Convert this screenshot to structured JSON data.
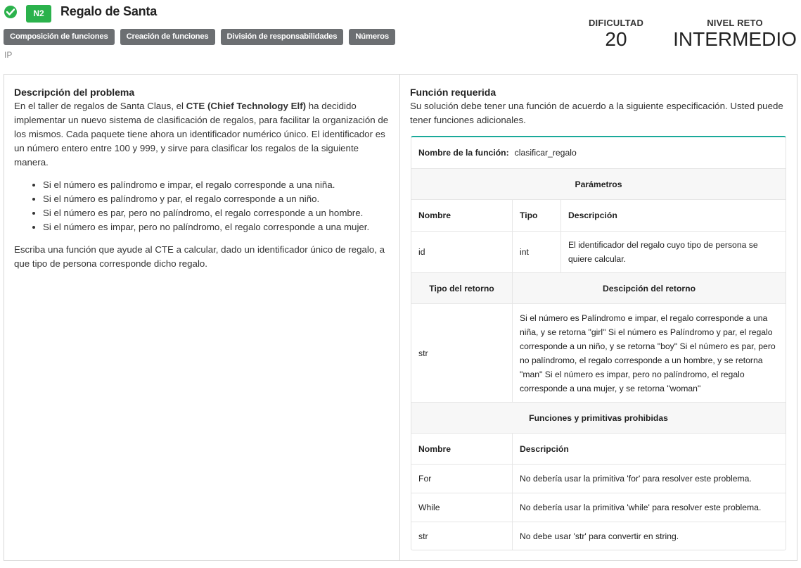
{
  "header": {
    "level": "N2",
    "title": "Regalo de Santa",
    "tags": [
      "Composición de funciones",
      "Creación de funciones",
      "División de responsabilidades",
      "Números"
    ],
    "subtitle": "IP",
    "difficulty_label": "DIFICULTAD",
    "difficulty_value": "20",
    "level_label": "NIVEL RETO",
    "level_value": "INTERMEDIO",
    "status_color": "#2bb24c"
  },
  "problem": {
    "heading": "Descripción del problema",
    "intro_before": "En el taller de regalos de Santa Claus, el ",
    "intro_bold": "CTE (Chief Technology Elf)",
    "intro_after": " ha decidido implementar un nuevo sistema de clasificación de regalos, para facilitar la organización de los mismos. Cada paquete tiene ahora un identificador numérico único. El identificador es un número entero entre 100 y 999, y sirve para clasificar los regalos de la siguiente manera.",
    "rules": [
      "Si el número es palíndromo e impar, el regalo corresponde a una niña.",
      "Si el número es palíndromo y par, el regalo corresponde a un niño.",
      "Si el número es par, pero no palíndromo, el regalo corresponde a un hombre.",
      "Si el número es impar, pero no palíndromo, el regalo corresponde a una mujer."
    ],
    "closing": "Escriba una función que ayude al CTE a calcular, dado un identificador único de regalo, a que tipo de persona corresponde dicho regalo."
  },
  "function_spec": {
    "heading": "Función requerida",
    "intro": "Su solución debe tener una función de acuerdo a la siguiente especificación. Usted puede tener funciones adicionales.",
    "name_label": "Nombre de la función:",
    "name_value": "clasificar_regalo",
    "params_title": "Parámetros",
    "params_headers": [
      "Nombre",
      "Tipo",
      "Descripción"
    ],
    "params": [
      {
        "name": "id",
        "type": "int",
        "description": "El identificador del regalo cuyo tipo de persona se quiere calcular."
      }
    ],
    "return_headers": [
      "Tipo del retorno",
      "Descipción del retorno"
    ],
    "return_type": "str",
    "return_description": "Si el número es Palíndromo e impar, el regalo corresponde a una niña, y se retorna \"girl\" Si el número es Palíndromo y par, el regalo corresponde a un niño, y se retorna \"boy\" Si el número es par, pero no palíndromo, el regalo corresponde a un hombre, y se retorna \"man\" Si el número es impar, pero no palíndromo, el regalo corresponde a una mujer, y se retorna \"woman\"",
    "forbidden_title": "Funciones y primitivas prohibidas",
    "forbidden_headers": [
      "Nombre",
      "Descripción"
    ],
    "forbidden": [
      {
        "name": "For",
        "description": "No debería usar la primitiva 'for' para resolver este problema."
      },
      {
        "name": "While",
        "description": "No debería usar la primitiva 'while' para resolver este problema."
      },
      {
        "name": "str",
        "description": "No debe usar 'str' para convertir en string."
      }
    ],
    "accent_color": "#1aa99a"
  }
}
